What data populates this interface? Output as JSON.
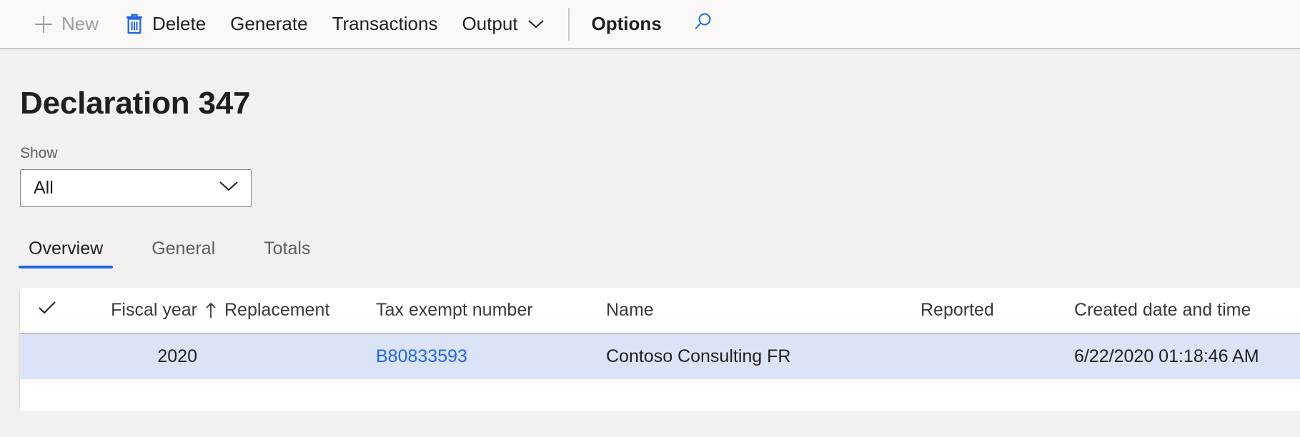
{
  "toolbar": {
    "items": [
      {
        "label": "New",
        "icon": "plus-icon",
        "disabled": true,
        "caret": false
      },
      {
        "label": "Delete",
        "icon": "trash-icon",
        "disabled": false,
        "caret": false
      },
      {
        "label": "Generate",
        "icon": "",
        "disabled": false,
        "caret": false
      },
      {
        "label": "Transactions",
        "icon": "",
        "disabled": false,
        "caret": false
      },
      {
        "label": "Output",
        "icon": "",
        "disabled": false,
        "caret": true
      }
    ],
    "options_label": "Options",
    "search_icon": "search-icon"
  },
  "page": {
    "title": "Declaration 347"
  },
  "filter": {
    "label": "Show",
    "value": "All",
    "chevron_icon": "chevron-down-icon"
  },
  "tabs": [
    {
      "label": "Overview",
      "active": true
    },
    {
      "label": "General",
      "active": false
    },
    {
      "label": "Totals",
      "active": false
    }
  ],
  "grid": {
    "select_all_icon": "checkmark-icon",
    "sort_icon": "arrow-up-icon",
    "columns": [
      "Fiscal year",
      "Replacement",
      "Tax exempt number",
      "Name",
      "Reported",
      "Created date and time"
    ],
    "rows": [
      {
        "fiscal_year": "2020",
        "replacement": "",
        "tax_exempt_number": "B80833593",
        "name": "Contoso Consulting FR",
        "reported": "",
        "created_date_time": "6/22/2020 01:18:46 AM",
        "selected": true
      }
    ]
  },
  "colors": {
    "accent": "#2266e3",
    "toolbar_bg": "#faf9f8",
    "page_bg": "#f2f1f0",
    "row_selected": "#dbe4f7",
    "disabled_text": "#a19f9d"
  }
}
